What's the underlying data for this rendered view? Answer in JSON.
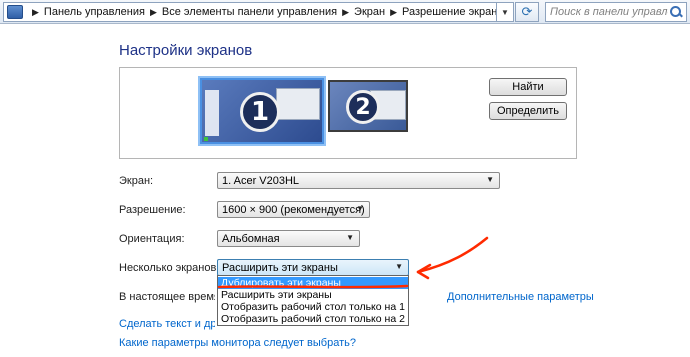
{
  "address_bar": {
    "breadcrumbs": [
      "Панель управления",
      "Все элементы панели управления",
      "Экран",
      "Разрешение экрана"
    ],
    "search_placeholder": "Поиск в панели управления"
  },
  "page_title": "Настройки экранов",
  "monitors": [
    {
      "number": "1",
      "selected": true
    },
    {
      "number": "2",
      "selected": false
    }
  ],
  "buttons": {
    "find": "Найти",
    "identify": "Определить"
  },
  "settings": {
    "display_label": "Экран:",
    "display_value": "1. Acer V203HL",
    "resolution_label": "Разрешение:",
    "resolution_value": "1600 × 900 (рекомендуется)",
    "orientation_label": "Ориентация:",
    "orientation_value": "Альбомная",
    "multiple_label": "Несколько экранов:",
    "multiple_value": "Расширить эти экраны"
  },
  "multiple_options": [
    "Дублировать эти экраны",
    "Расширить эти экраны",
    "Отобразить рабочий стол только на 1",
    "Отобразить рабочий стол только на 2"
  ],
  "info_text": "В настоящее время эт",
  "links": {
    "advanced": "Дополнительные параметры",
    "text_size": "Сделать текст и другие",
    "which_settings": "Какие параметры монитора следует выбрать?"
  },
  "colors": {
    "accent": "#1e3287",
    "link": "#0066cc",
    "highlight": "#3399ff",
    "annotation": "#ff2a00"
  }
}
